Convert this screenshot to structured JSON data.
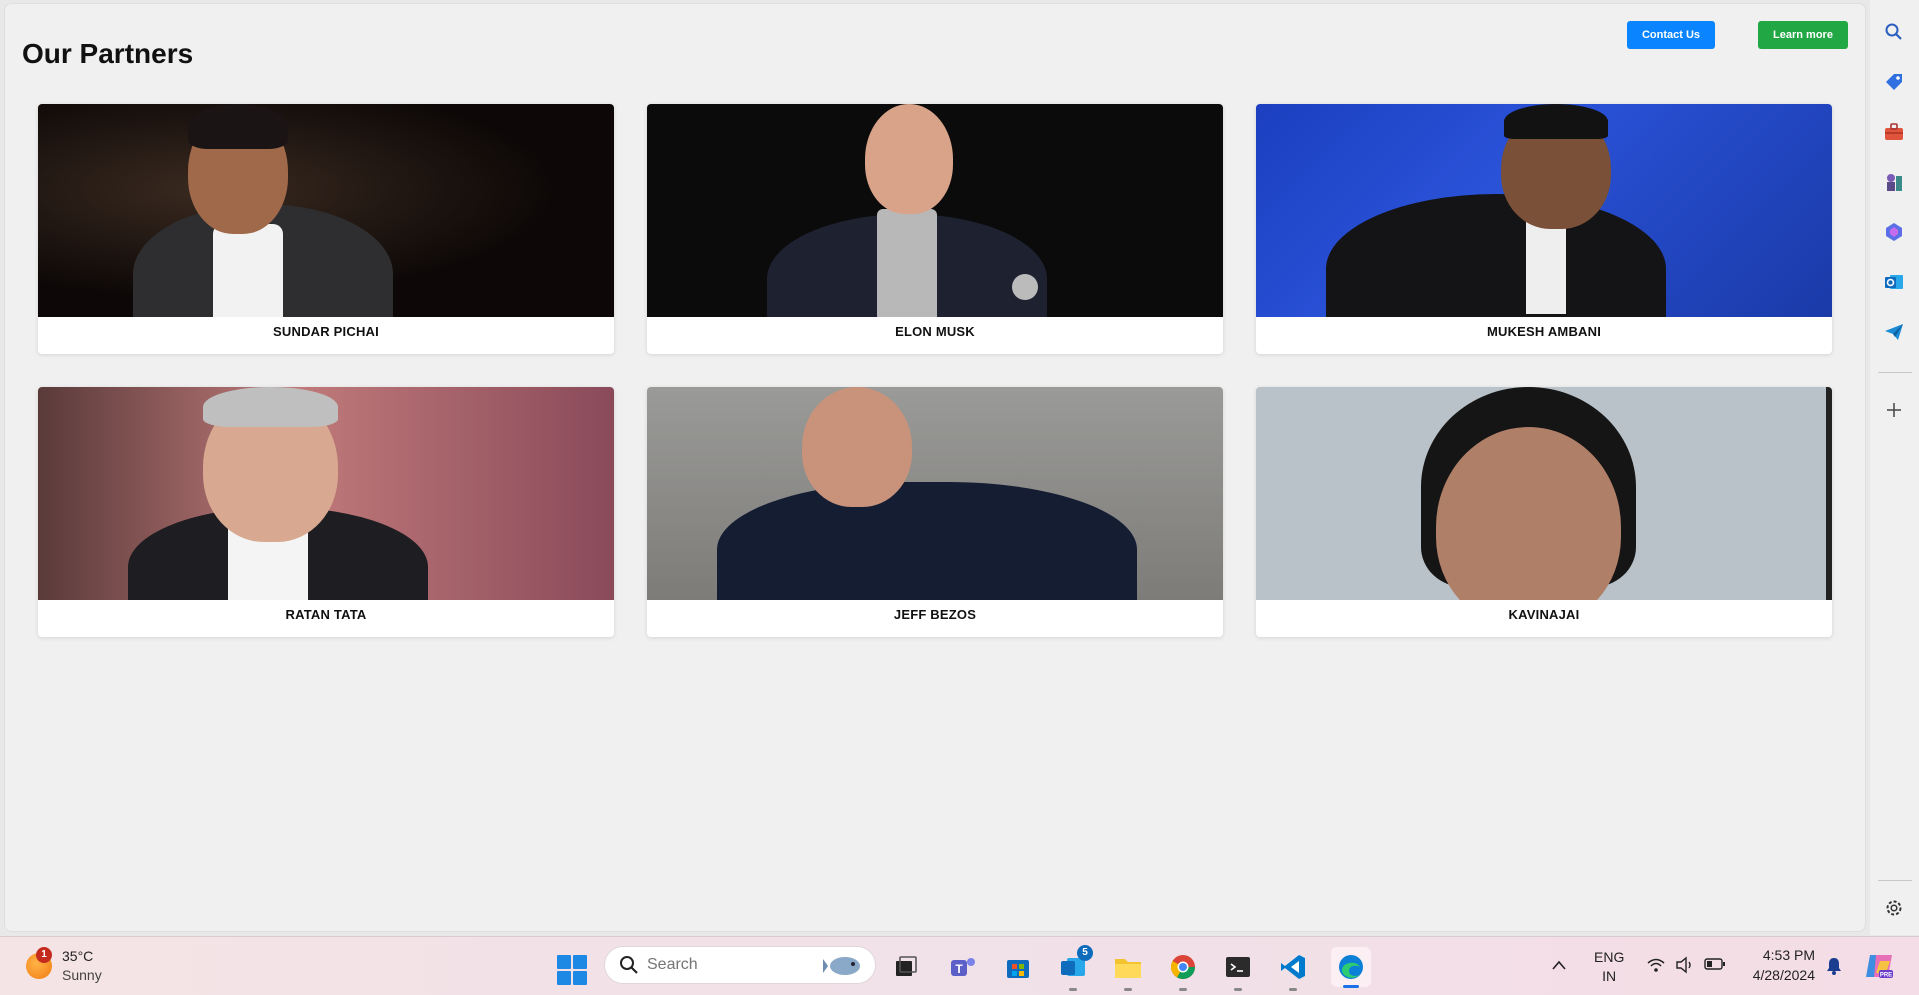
{
  "page": {
    "title": "Our Partners",
    "buttons": {
      "contact": "Contact Us",
      "learn": "Learn more"
    },
    "colors": {
      "contact": "#0a84ff",
      "learn": "#22a745"
    }
  },
  "partners": [
    {
      "name": "SUNDAR PICHAI"
    },
    {
      "name": "ELON MUSK"
    },
    {
      "name": "MUKESH AMBANI"
    },
    {
      "name": "RATAN TATA"
    },
    {
      "name": "JEFF BEZOS"
    },
    {
      "name": "KAVINAJAI"
    }
  ],
  "sidebar": {
    "icons": [
      "search-icon",
      "tag-icon",
      "briefcase-icon",
      "chess-icon",
      "copilot-icon",
      "outlook-icon",
      "send-icon",
      "add-icon",
      "settings-icon"
    ]
  },
  "taskbar": {
    "weather": {
      "temp": "35°C",
      "condition": "Sunny",
      "badge": "1"
    },
    "search": {
      "placeholder": "Search"
    },
    "outlook_badge": "5",
    "language": {
      "line1": "ENG",
      "line2": "IN"
    },
    "time": "4:53 PM",
    "date": "4/28/2024"
  }
}
